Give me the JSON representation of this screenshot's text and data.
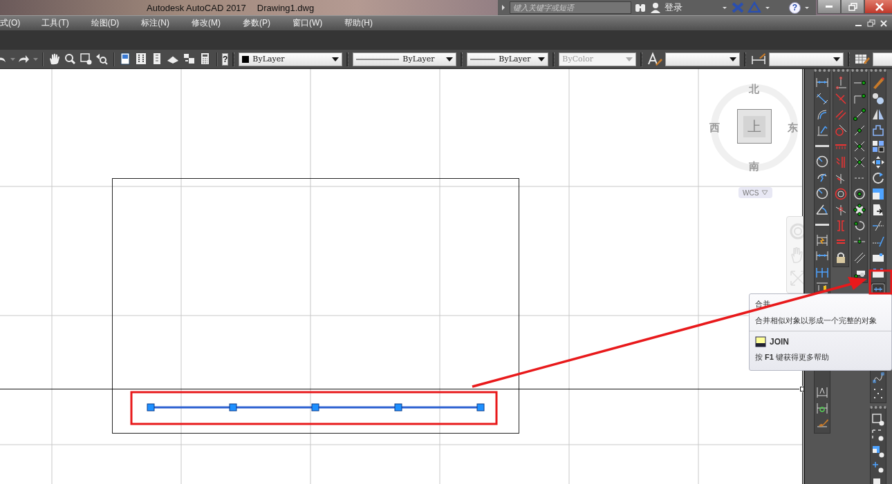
{
  "window": {
    "title": "Autodesk AutoCAD 2017",
    "document": "Drawing1.dwg"
  },
  "search": {
    "placeholder": "键入关键字或短语"
  },
  "account": {
    "label": "登录"
  },
  "help_button": "?",
  "menu": [
    "式(O)",
    "工具(T)",
    "绘图(D)",
    "标注(N)",
    "修改(M)",
    "参数(P)",
    "窗口(W)",
    "帮助(H)"
  ],
  "toolbar": {
    "help_icon": "?",
    "dropdowns": [
      {
        "kind": "color",
        "value": "ByLayer",
        "disabled": false
      },
      {
        "kind": "linetype",
        "value": "ByLayer",
        "disabled": false
      },
      {
        "kind": "lineweight",
        "value": "ByLayer",
        "disabled": false
      },
      {
        "kind": "plotstyle",
        "value": "ByColor",
        "disabled": true
      },
      {
        "kind": "textstyle",
        "disabled": false
      },
      {
        "kind": "dimstyle",
        "disabled": false
      },
      {
        "kind": "tablestyle",
        "disabled": false
      }
    ]
  },
  "viewcube": {
    "north": "北",
    "east": "东",
    "south": "南",
    "west": "西",
    "face": "上",
    "ucs": "WCS"
  },
  "tooltip": {
    "title": "合并",
    "description": "合并相似对象以形成一个完整的对象",
    "command": "JOIN",
    "help": "按 **F1** 键获得更多帮助"
  }
}
